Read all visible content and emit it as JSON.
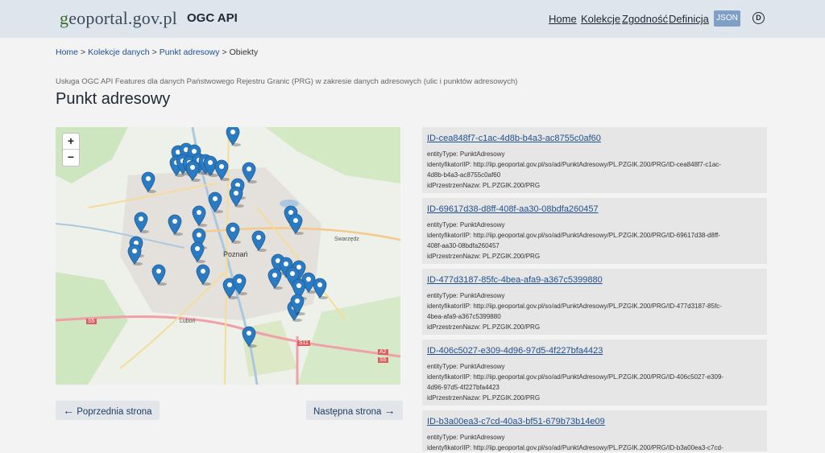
{
  "header": {
    "logo_prefix": "g",
    "logo_rest": "eoportal.gov.pl",
    "app_title": "OGC API",
    "nav": [
      "Home",
      "Kolekcje",
      "Zgodność",
      "Definicja"
    ],
    "json_label": "JSON",
    "theme_glyph": "D"
  },
  "breadcrumb": {
    "items": [
      "Home",
      "Kolekcje danych",
      "Punkt adresowy",
      "Obiekty"
    ],
    "separator": ">"
  },
  "page": {
    "subtitle": "Usługa OGC API Features dla danych Państwowego Rejestru Granic (PRG) w zakresie danych adresowych (ulic i punktów adresowych)",
    "title": "Punkt adresowy"
  },
  "map": {
    "zoom_in": "+",
    "zoom_out": "−",
    "labels": [
      "Poznań",
      "Swarzędz",
      "Luboń",
      "S5",
      "S11",
      "A2",
      "S5"
    ],
    "marker_color": "#2b7bc2"
  },
  "pagination": {
    "prev": "Poprzednia strona",
    "next": "Następna strona",
    "prev_icon": "←",
    "next_icon": "→"
  },
  "features": [
    {
      "id": "ID-cea848f7-c1ac-4d8b-b4a3-ac8755c0af60",
      "entityType": "entityType: PunktAdresowy",
      "identyfikator_1": "identyfikatorIIP: http://iip.geoportal.gov.pl/so/ad/PunktAdresowy/PL.PZGIK.200/PRG/ID-cea848f7-c1ac-",
      "identyfikator_2": "4d8b-b4a3-ac8755c0af60",
      "przestrzen": "idPrzestrzenNazw: PL.PZGIK.200/PRG"
    },
    {
      "id": "ID-69617d38-d8ff-408f-aa30-08bdfa260457",
      "entityType": "entityType: PunktAdresowy",
      "identyfikator_1": "identyfikatorIIP: http://iip.geoportal.gov.pl/so/ad/PunktAdresowy/PL.PZGIK.200/PRG/ID-69617d38-d8ff-",
      "identyfikator_2": "408f-aa30-08bdfa260457",
      "przestrzen": "idPrzestrzenNazw: PL.PZGIK.200/PRG"
    },
    {
      "id": "ID-477d3187-85fc-4bea-afa9-a367c5399880",
      "entityType": "entityType: PunktAdresowy",
      "identyfikator_1": "identyfikatorIIP: http://iip.geoportal.gov.pl/so/ad/PunktAdresowy/PL.PZGIK.200/PRG/ID-477d3187-85fc-",
      "identyfikator_2": "4bea-afa9-a367c5399880",
      "przestrzen": "idPrzestrzenNazw: PL.PZGIK.200/PRG"
    },
    {
      "id": "ID-406c5027-e309-4d96-97d5-4f227bfa4423",
      "entityType": "entityType: PunktAdresowy",
      "identyfikator_1": "identyfikatorIIP: http://iip.geoportal.gov.pl/so/ad/PunktAdresowy/PL.PZGIK.200/PRG/ID-406c5027-e309-",
      "identyfikator_2": "4d96-97d5-4f227bfa4423",
      "przestrzen": "idPrzestrzenNazw: PL.PZGIK.200/PRG"
    },
    {
      "id": "ID-b3a00ea3-c7cd-40a3-bf51-679b73b14e09",
      "entityType": "entityType: PunktAdresowy",
      "identyfikator_1": "identyfikatorIIP: http://iip.geoportal.gov.pl/so/ad/PunktAdresowy/PL.PZGIK.200/PRG/ID-b3a00ea3-c7cd-",
      "identyfikator_2": "",
      "przestrzen": ""
    }
  ]
}
